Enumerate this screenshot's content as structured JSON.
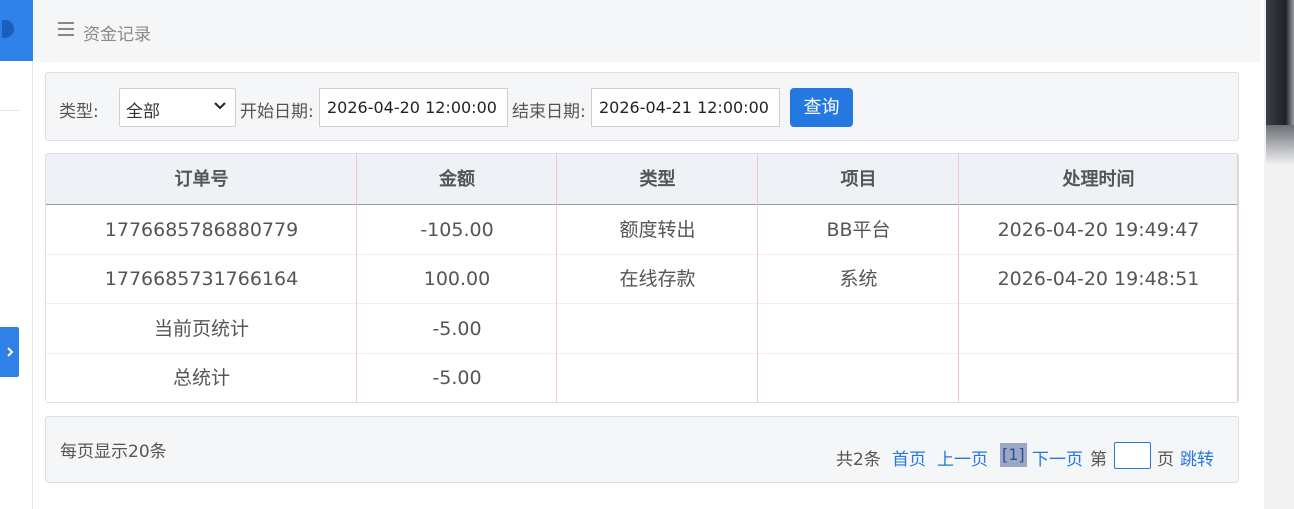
{
  "header": {
    "title": "资金记录"
  },
  "filter": {
    "type_label": "类型:",
    "type_value": "全部",
    "start_label": "开始日期:",
    "start_value": "2026-04-20 12:00:00",
    "end_label": "结束日期:",
    "end_value": "2026-04-21 12:00:00",
    "query_label": "查询"
  },
  "table": {
    "columns": [
      "订单号",
      "金额",
      "类型",
      "项目",
      "处理时间"
    ],
    "rows": [
      [
        "1776685786880779",
        "-105.00",
        "额度转出",
        "BB平台",
        "2026-04-20 19:49:47"
      ],
      [
        "1776685731766164",
        "100.00",
        "在线存款",
        "系统",
        "2026-04-20 19:48:51"
      ]
    ],
    "page_total": {
      "label": "当前页统计",
      "amount": "-5.00"
    },
    "grand_total": {
      "label": "总统计",
      "amount": "-5.00"
    }
  },
  "pager": {
    "per_page": "每页显示20条",
    "total": "共2条",
    "first": "首页",
    "prev": "上一页",
    "current": "[1]",
    "next": "下一页",
    "goto_prefix": "第",
    "goto_suffix": "页",
    "jump": "跳转"
  }
}
